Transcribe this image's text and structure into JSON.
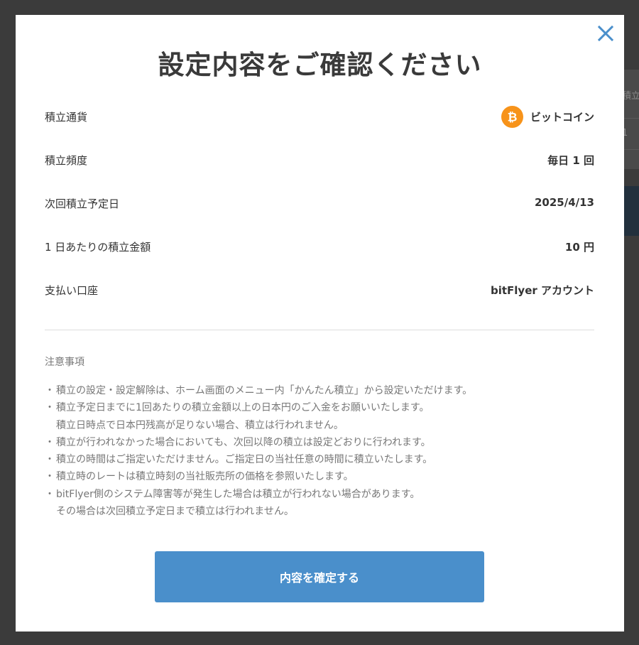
{
  "background": {
    "partial_header": "積立",
    "partial_cell": "1"
  },
  "modal": {
    "title": "設定内容をご確認ください",
    "close_icon": "close-icon",
    "rows": [
      {
        "label": "積立通貨",
        "value": "ビットコイン",
        "icon": "bitcoin-icon",
        "icon_symbol": "₿"
      },
      {
        "label": "積立頻度",
        "value": "毎日 1 回"
      },
      {
        "label": "次回積立予定日",
        "value": "2025/4/13"
      },
      {
        "label": "1 日あたりの積立金額",
        "value": "10 円"
      },
      {
        "label": "支払い口座",
        "value": "bitFlyer アカウント"
      }
    ],
    "notes_heading": "注意事項",
    "notes": [
      {
        "line": "積立の設定・設定解除は、ホーム画面のメニュー内「かんたん積立」から設定いただけます。",
        "cont": ""
      },
      {
        "line": "積立予定日までに1回あたりの積立金額以上の日本円のご入金をお願いいたします。",
        "cont": "積立日時点で日本円残高が足りない場合、積立は行われません。"
      },
      {
        "line": "積立が行われなかった場合においても、次回以降の積立は設定どおりに行われます。",
        "cont": ""
      },
      {
        "line": "積立の時間はご指定いただけません。ご指定日の当社任意の時間に積立いたします。",
        "cont": ""
      },
      {
        "line": "積立時のレートは積立時刻の当社販売所の価格を参照いたします。",
        "cont": ""
      },
      {
        "line": "bitFlyer側のシステム障害等が発生した場合は積立が行われない場合があります。",
        "cont": "その場合は次回積立予定日まで積立は行われません。"
      }
    ],
    "confirm_label": "内容を確定する"
  },
  "colors": {
    "overlay": "#3b3b3b",
    "accent": "#4a8fcb",
    "bitcoin": "#f7931a",
    "close": "#4a8fcb"
  }
}
